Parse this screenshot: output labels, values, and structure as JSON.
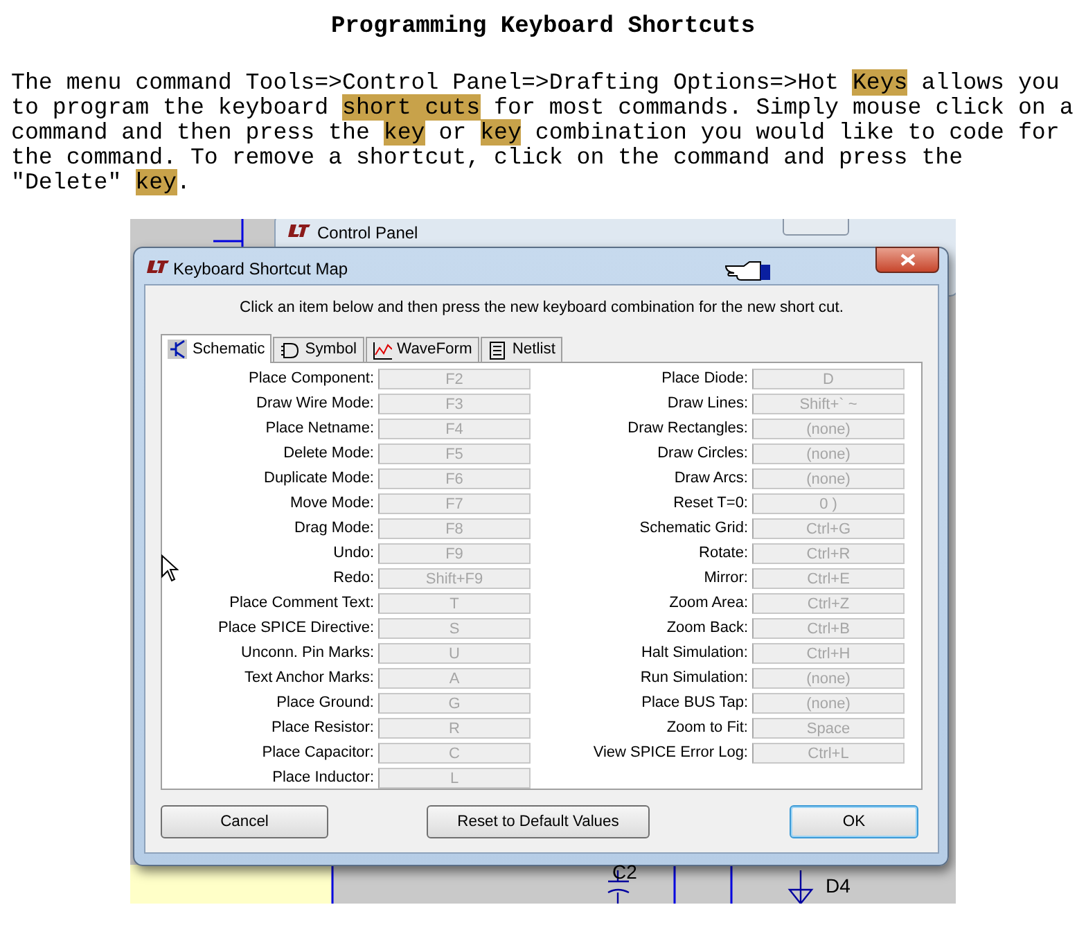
{
  "document": {
    "title": "Programming Keyboard Shortcuts",
    "paragraph": [
      {
        "text": "The menu command Tools=>Control Panel=>Drafting Options=>Hot ",
        "highlighted": false
      },
      {
        "text": "Keys",
        "highlighted": true
      },
      {
        "text": " allows you to program the keyboard ",
        "highlighted": false
      },
      {
        "text": "short cuts",
        "highlighted": true
      },
      {
        "text": " for most commands. Simply mouse click on a command and then press the ",
        "highlighted": false
      },
      {
        "text": "key",
        "highlighted": true
      },
      {
        "text": " or ",
        "highlighted": false
      },
      {
        "text": "key",
        "highlighted": true
      },
      {
        "text": " combination you would like to code for the command. To remove a shortcut, click on the command and press the \"Delete\" ",
        "highlighted": false
      },
      {
        "text": "key",
        "highlighted": true
      },
      {
        "text": ".",
        "highlighted": false
      }
    ]
  },
  "screenshot": {
    "background_window": {
      "title": "Control Panel"
    },
    "schematic_labels": [
      "C2",
      "D4"
    ],
    "dialog": {
      "title": "Keyboard Shortcut Map",
      "instruction": "Click an item below and then press the new keyboard combination for the new short cut.",
      "tabs": [
        {
          "label": "Schematic",
          "selected": true
        },
        {
          "label": "Symbol",
          "selected": false
        },
        {
          "label": "WaveForm",
          "selected": false
        },
        {
          "label": "Netlist",
          "selected": false
        }
      ],
      "left_shortcuts": [
        {
          "command": "Place Component:",
          "key": "F2",
          "disabled": true
        },
        {
          "command": "Draw Wire Mode:",
          "key": "F3",
          "disabled": true
        },
        {
          "command": "Place Netname:",
          "key": "F4",
          "disabled": true
        },
        {
          "command": "Delete Mode:",
          "key": "F5",
          "disabled": true
        },
        {
          "command": "Duplicate Mode:",
          "key": "F6",
          "disabled": true
        },
        {
          "command": "Move Mode:",
          "key": "F7",
          "disabled": true
        },
        {
          "command": "Drag Mode:",
          "key": "F8",
          "disabled": true
        },
        {
          "command": "Undo:",
          "key": "F9",
          "disabled": true
        },
        {
          "command": "Redo:",
          "key": "Shift+F9",
          "disabled": true
        },
        {
          "command": "Place Comment Text:",
          "key": "T",
          "disabled": true
        },
        {
          "command": "Place SPICE Directive:",
          "key": "S",
          "disabled": true
        },
        {
          "command": "Unconn. Pin Marks:",
          "key": "U",
          "disabled": true
        },
        {
          "command": "Text Anchor Marks:",
          "key": "A",
          "disabled": true
        },
        {
          "command": "Place Ground:",
          "key": "G",
          "disabled": true
        },
        {
          "command": "Place Resistor:",
          "key": "R",
          "disabled": true
        },
        {
          "command": "Place Capacitor:",
          "key": "C",
          "disabled": true
        },
        {
          "command": "Place Inductor:",
          "key": "L",
          "disabled": true
        }
      ],
      "right_shortcuts": [
        {
          "command": "Place Diode:",
          "key": "D",
          "disabled": true
        },
        {
          "command": "Draw Lines:",
          "key": "Shift+` ~",
          "disabled": true
        },
        {
          "command": "Draw Rectangles:",
          "key": "(none)",
          "disabled": true
        },
        {
          "command": "Draw Circles:",
          "key": "(none)",
          "disabled": true
        },
        {
          "command": "Draw Arcs:",
          "key": "(none)",
          "disabled": true
        },
        {
          "command": "Reset T=0:",
          "key": "0 )",
          "disabled": true
        },
        {
          "command": "Schematic Grid:",
          "key": "Ctrl+G",
          "disabled": true
        },
        {
          "command": "Rotate:",
          "key": "Ctrl+R",
          "disabled": true
        },
        {
          "command": "Mirror:",
          "key": "Ctrl+E",
          "disabled": true
        },
        {
          "command": "Zoom Area:",
          "key": "Ctrl+Z",
          "disabled": true
        },
        {
          "command": "Zoom Back:",
          "key": "Ctrl+B",
          "disabled": true
        },
        {
          "command": "Halt Simulation:",
          "key": "Ctrl+H",
          "disabled": true
        },
        {
          "command": "Run Simulation:",
          "key": "(none)",
          "disabled": true
        },
        {
          "command": "Place BUS Tap:",
          "key": "(none)",
          "disabled": true
        },
        {
          "command": "Zoom to Fit:",
          "key": "Space",
          "disabled": true
        },
        {
          "command": "View SPICE Error Log:",
          "key": "Ctrl+L",
          "disabled": true
        }
      ],
      "buttons": [
        {
          "label": "Cancel",
          "default": false
        },
        {
          "label": "Reset to Default Values",
          "default": false
        },
        {
          "label": "OK",
          "default": true
        }
      ]
    }
  }
}
